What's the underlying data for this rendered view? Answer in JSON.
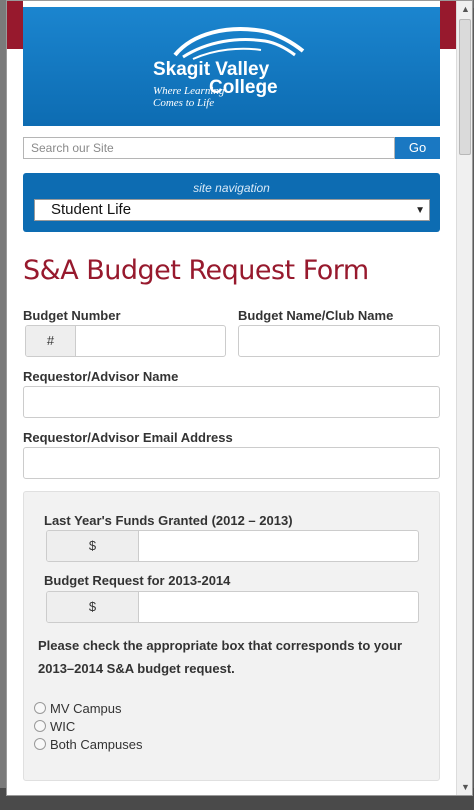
{
  "header": {
    "logo_line1": "Skagit Valley",
    "logo_line2": "College",
    "tagline_line1": "Where Learning",
    "tagline_line2": "Comes to Life"
  },
  "search": {
    "placeholder": "Search our Site",
    "go_label": "Go"
  },
  "site_nav": {
    "title": "site navigation",
    "selected": "Student Life"
  },
  "form": {
    "title": "S&A Budget Request Form",
    "budget_number_label": "Budget Number",
    "budget_number_prefix": "#",
    "budget_name_label": "Budget Name/Club Name",
    "requestor_name_label": "Requestor/Advisor Name",
    "requestor_email_label": "Requestor/Advisor Email Address",
    "funds": {
      "last_year_label": "Last Year's Funds Granted (2012 – 2013)",
      "currency_prefix": "$",
      "request_label": "Budget Request for 2013-2014",
      "instructions": "Please check the appropriate box that corresponds to your 2013–2014 S&A budget request.",
      "options": [
        "MV Campus",
        "WIC",
        "Both Campuses"
      ]
    }
  },
  "colors": {
    "brand_blue": "#0d6cb2",
    "brand_red": "#97192d"
  }
}
